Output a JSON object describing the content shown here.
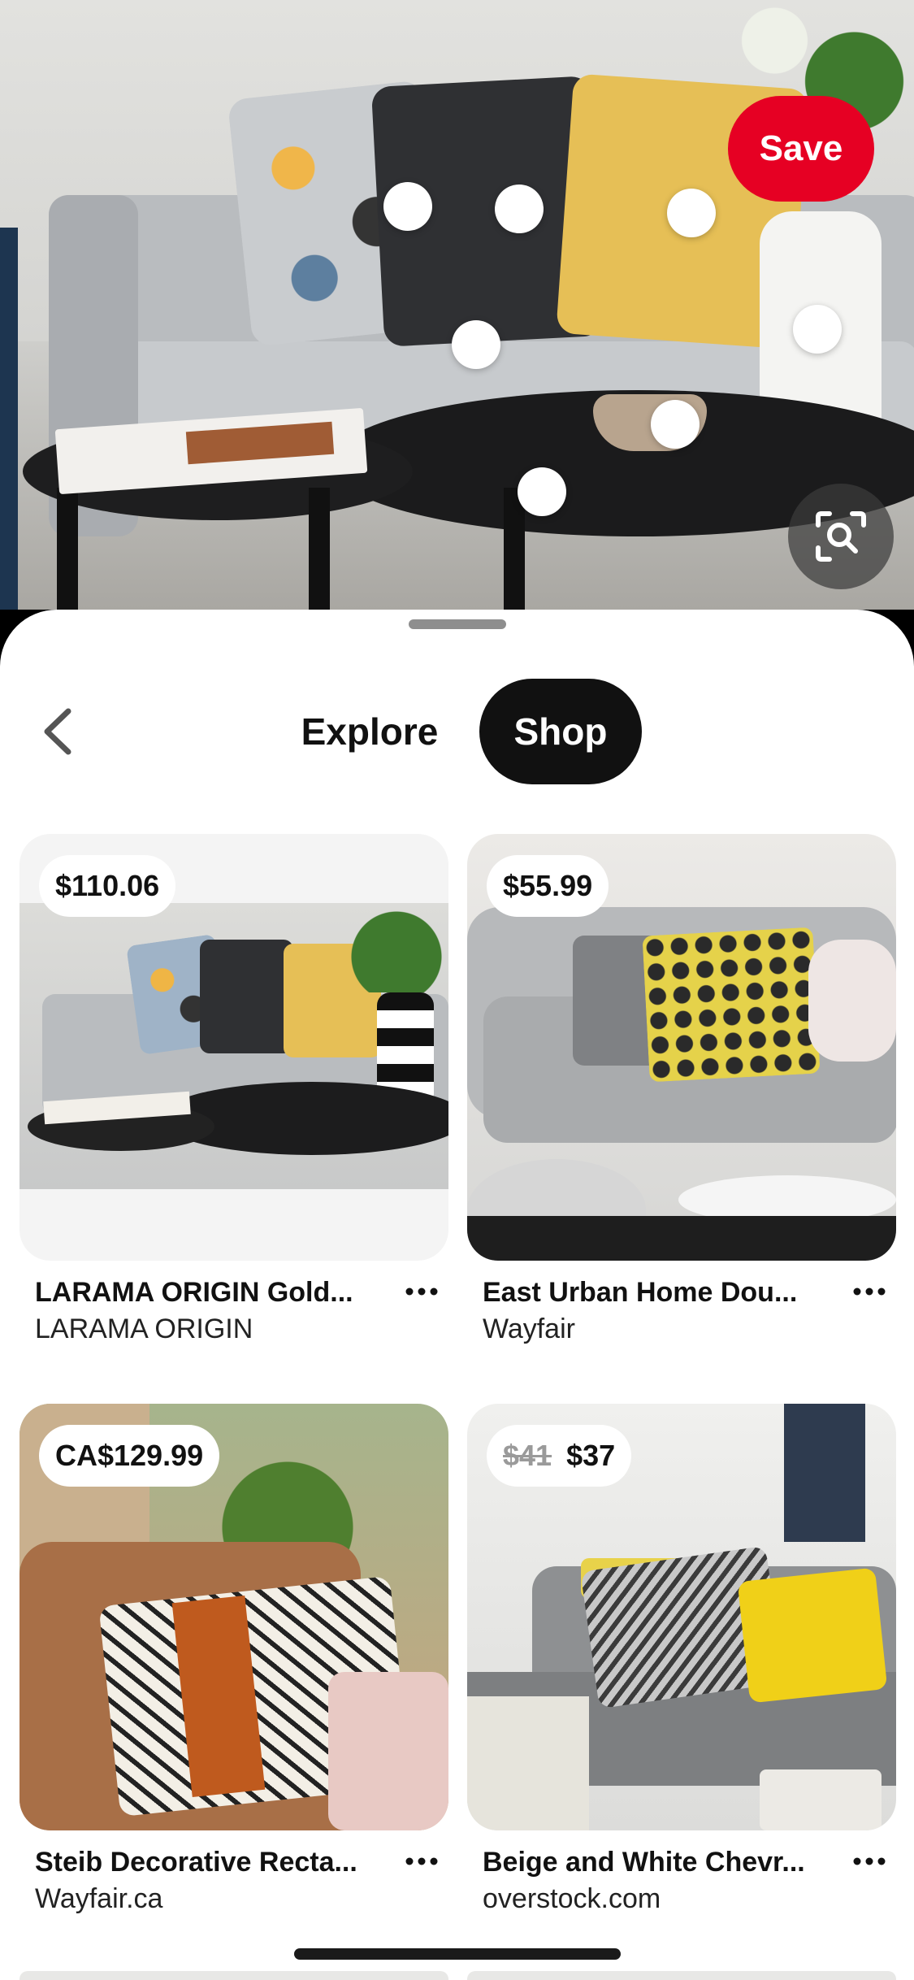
{
  "hero": {
    "save_label": "Save",
    "visual_search_icon": "scan-search-icon"
  },
  "tabs": {
    "explore_label": "Explore",
    "shop_label": "Shop",
    "active": "Shop"
  },
  "products": [
    {
      "price": "$110.06",
      "old_price": "",
      "title": "LARAMA ORIGIN Gold...",
      "seller": "LARAMA ORIGIN"
    },
    {
      "price": "$55.99",
      "old_price": "",
      "title": "East Urban Home Dou...",
      "seller": "Wayfair"
    },
    {
      "price": "CA$129.99",
      "old_price": "",
      "title": "Steib Decorative Recta...",
      "seller": "Wayfair.ca"
    },
    {
      "price": "$37",
      "old_price": "$41",
      "title": "Beige and White Chevr...",
      "seller": "overstock.com"
    }
  ],
  "colors": {
    "save_red": "#e60023",
    "tab_active_bg": "#111111",
    "sheet_bg": "#ffffff"
  }
}
